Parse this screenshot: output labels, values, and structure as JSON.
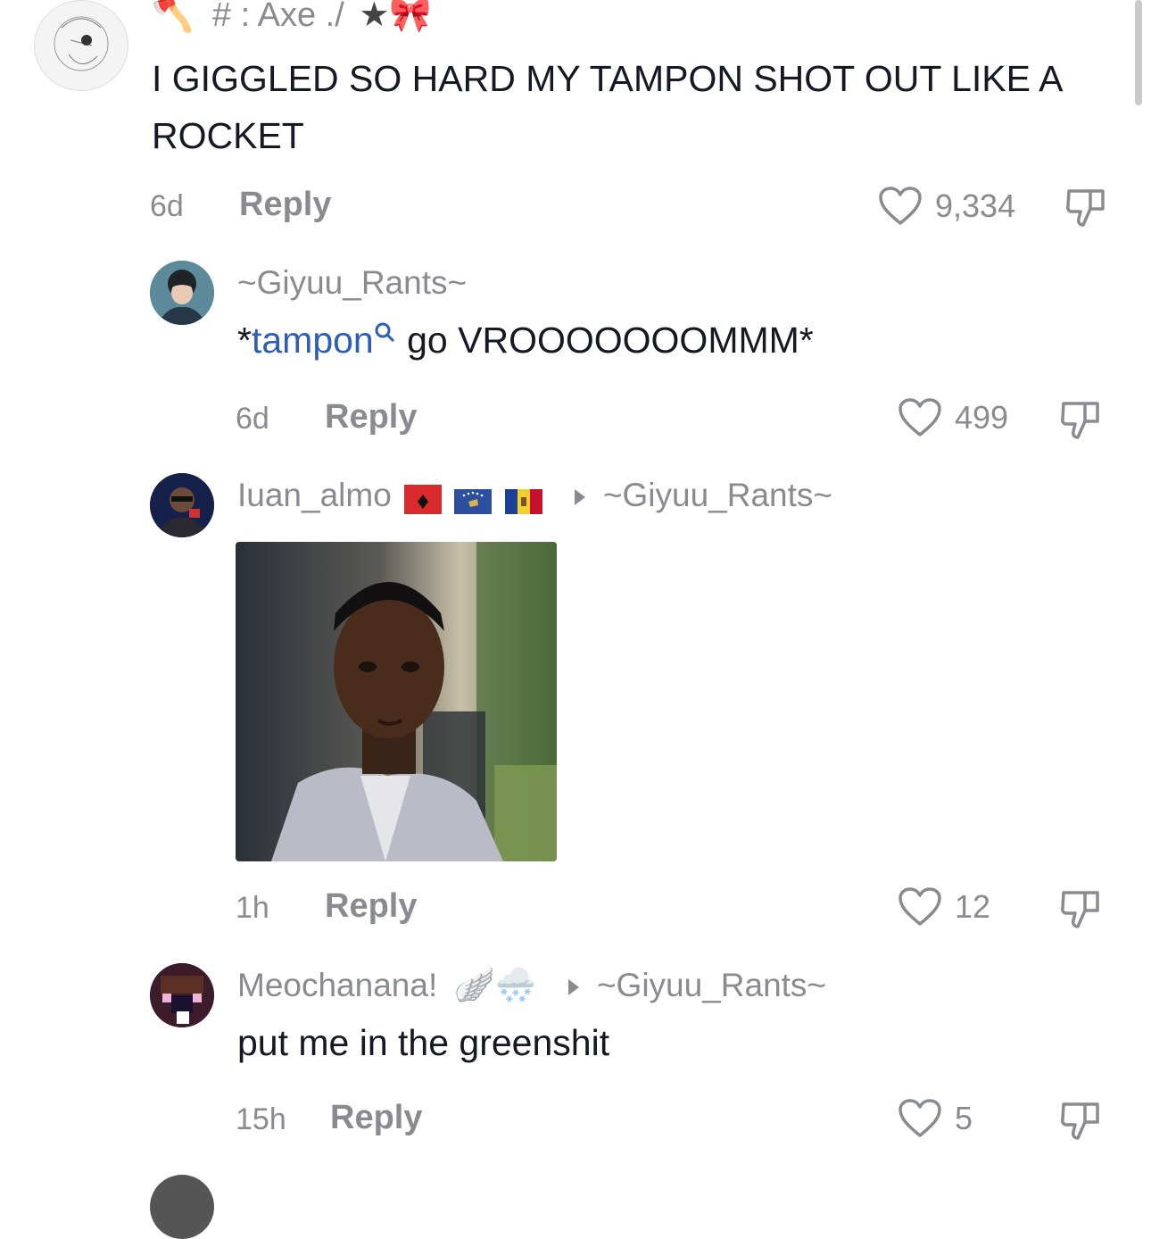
{
  "comments": [
    {
      "username": "# : Axe ./",
      "username_decor": "🪓 ★🎀",
      "text": "I GIGGLED SO HARD MY TAMPON SHOT OUT LIKE A ROCKET",
      "time": "6d",
      "reply": "Reply",
      "likes": "9,334"
    },
    {
      "username": "~Giyuu_Rants~",
      "text_prefix": "*",
      "text_link": "tampon",
      "text_suffix": " go VROOOOOOOMMM*",
      "time": "6d",
      "reply": "Reply",
      "likes": "499"
    },
    {
      "username": "Iuan_almo",
      "flags": [
        "albania-flag",
        "kosovo-flag",
        "moldova-flag"
      ],
      "reply_to": "~Giyuu_Rants~",
      "image": "reply-photo",
      "time": "1h",
      "reply": "Reply",
      "likes": "12"
    },
    {
      "username": "Meochanana!",
      "username_decor": "🪽🌨️",
      "reply_to": "~Giyuu_Rants~",
      "text": "put me in the greenshit",
      "time": "15h",
      "reply": "Reply",
      "likes": "5"
    }
  ],
  "colors": {
    "link": "#2b5db9",
    "muted": "#8a8b91",
    "text": "#161823"
  },
  "icons": [
    "heart-outline-icon",
    "thumbs-down-icon",
    "search-mini-icon",
    "reply-arrow-icon"
  ]
}
